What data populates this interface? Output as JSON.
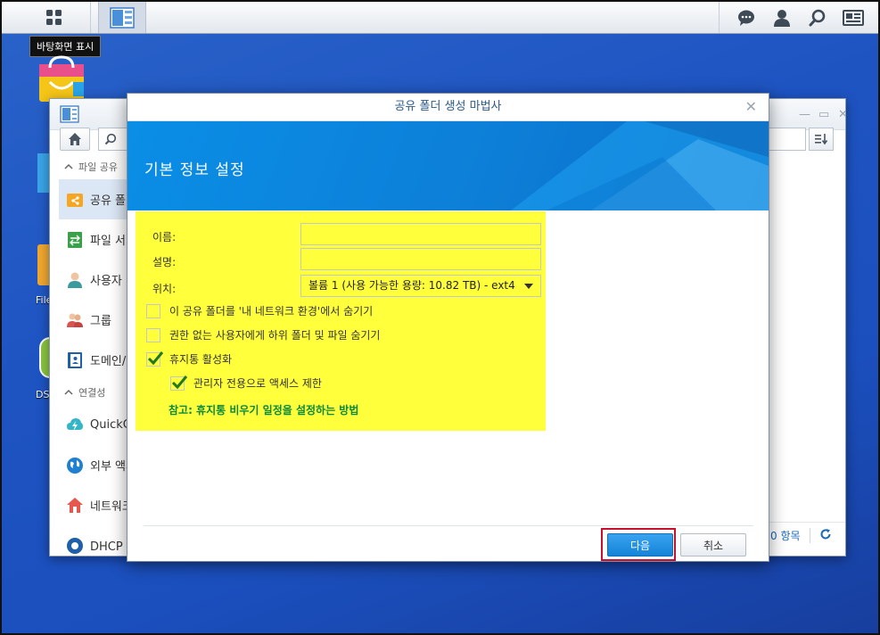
{
  "taskbar": {
    "desktop_tooltip": "바탕화면 표시"
  },
  "desktop": {
    "icons": [
      {
        "label": "File"
      },
      {
        "label": "DS"
      }
    ]
  },
  "bg_window": {
    "sidebar": {
      "section_file": "파일 공유",
      "items_file": [
        {
          "label": "공유 폴더"
        },
        {
          "label": "파일 서비스"
        },
        {
          "label": "사용자"
        },
        {
          "label": "그룹"
        },
        {
          "label": "도메인/LDAP"
        }
      ],
      "section_conn": "연결성",
      "items_conn": [
        {
          "label": "QuickConnect"
        },
        {
          "label": "외부 액세스"
        },
        {
          "label": "네트워크"
        },
        {
          "label": "DHCP 서버"
        }
      ]
    },
    "footer": {
      "count": "0 항목"
    }
  },
  "wizard": {
    "title": "공유 폴더 생성 마법사",
    "banner_title": "기본 정보 설정",
    "fields": {
      "name_label": "이름:",
      "name_value": "",
      "desc_label": "설명:",
      "desc_value": "",
      "location_label": "위치:",
      "location_value": "볼륨 1 (사용 가능한 용량:  10.82 TB) - ext4"
    },
    "checkboxes": [
      {
        "label": "이 공유 폴더를 '내 네트워크 환경'에서 숨기기",
        "checked": false
      },
      {
        "label": "권한 없는 사용자에게 하위 폴더 및 파일 숨기기",
        "checked": false
      },
      {
        "label": "휴지통 활성화",
        "checked": true
      },
      {
        "label": "관리자 전용으로 액세스 제한",
        "checked": true
      }
    ],
    "note": "참고: 휴지통 비우기 일정을 설정하는 방법",
    "buttons": {
      "next": "다음",
      "cancel": "취소"
    }
  },
  "colors": {
    "highlight": "#ffff3c",
    "accent": "#1483d8",
    "desktop": "#1e54c2",
    "note": "#0a8a3a",
    "focus_frame": "#c8102e"
  }
}
